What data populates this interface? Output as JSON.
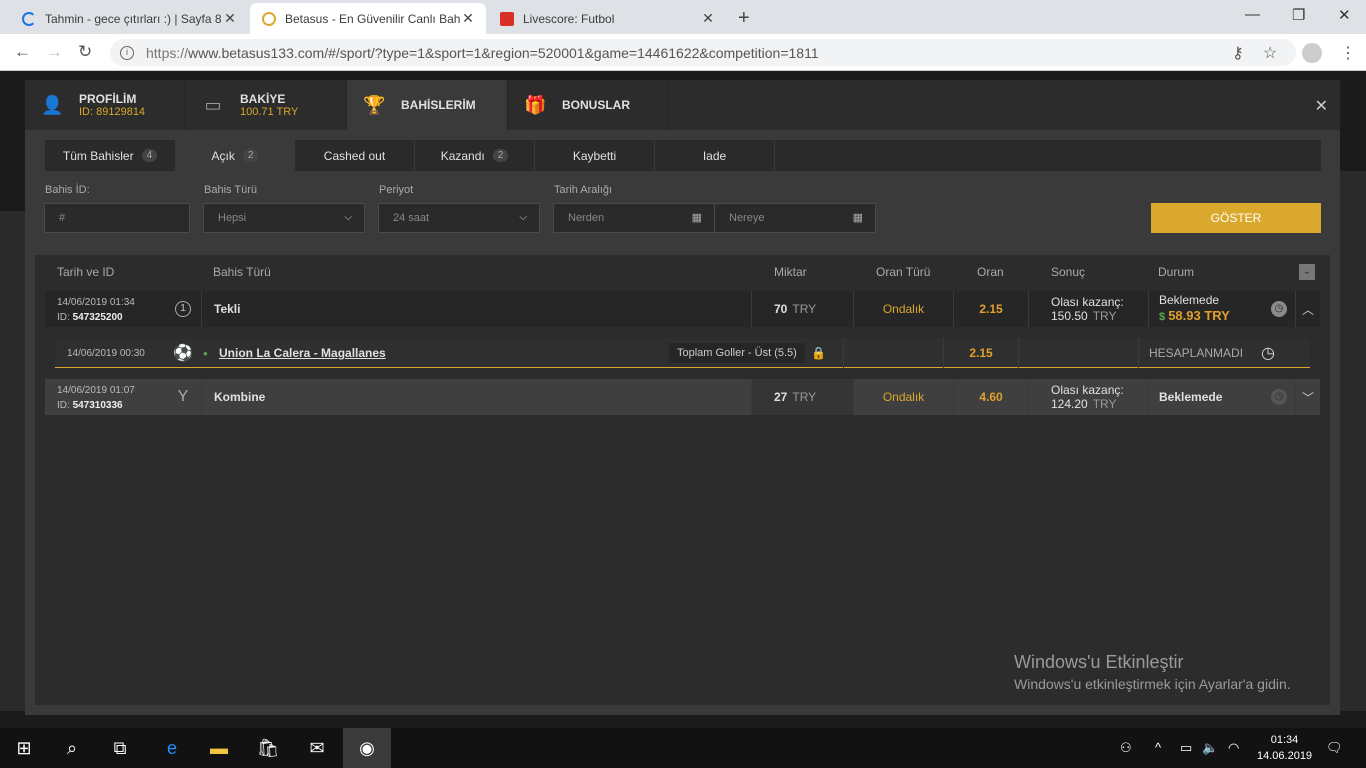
{
  "browser": {
    "tabs": [
      {
        "title": "Tahmin - gece çıtırları :) | Sayfa 8",
        "fav_color": "#1a73e8"
      },
      {
        "title": "Betasus - En Güvenilir Canlı Bahis",
        "fav_color": "#d9a82c"
      },
      {
        "title": "Livescore: Futbol",
        "fav_color": "#d93025"
      }
    ],
    "url_scheme": "https://",
    "url_rest": "www.betasus133.com/#/sport/?type=1&sport=1&region=520001&game=14461622&competition=1811"
  },
  "modal": {
    "tabs": [
      {
        "title": "PROFİLİM",
        "sub": "ID: 89129814",
        "icon": "user-icon"
      },
      {
        "title": "BAKİYE",
        "sub": "100.71 TRY",
        "icon": "wallet-icon"
      },
      {
        "title": "BAHİSLERİM",
        "sub": "",
        "icon": "trophy-icon"
      },
      {
        "title": "BONUSLAR",
        "sub": "",
        "icon": "gift-icon"
      }
    ],
    "subtabs": [
      {
        "label": "Tüm Bahisler",
        "count": "4"
      },
      {
        "label": "Açık",
        "count": "2"
      },
      {
        "label": "Cashed out",
        "count": ""
      },
      {
        "label": "Kazandı",
        "count": "2"
      },
      {
        "label": "Kaybetti",
        "count": ""
      },
      {
        "label": "Iade",
        "count": ""
      }
    ],
    "filters": {
      "bet_id_label": "Bahis İD:",
      "bet_id_placeholder": "#",
      "bet_type_label": "Bahis Türü",
      "bet_type_value": "Hepsi",
      "period_label": "Periyot",
      "period_value": "24 saat",
      "date_label": "Tarih Aralığı",
      "from": "Nerden",
      "to": "Nereye",
      "show": "GÖSTER"
    },
    "table": {
      "headers": [
        "Tarih ve ID",
        "Bahis Türü",
        "Miktar",
        "Oran Türü",
        "Oran",
        "Sonuç",
        "Durum"
      ],
      "rows": [
        {
          "date": "14/06/2019 01:34",
          "id_label": "ID:",
          "id": "547325200",
          "type": "Tekli",
          "type_icon": "1",
          "amount": "70",
          "cur": "TRY",
          "odds_type": "Ondalık",
          "odds": "2.15",
          "result_label": "Olası kazanç:",
          "result": "150.50",
          "status": "Beklemede",
          "cashout": "58.93 TRY"
        },
        {
          "date": "14/06/2019 01:07",
          "id_label": "ID:",
          "id": "547310336",
          "type": "Kombine",
          "type_icon": "Y",
          "amount": "27",
          "cur": "TRY",
          "odds_type": "Ondalık",
          "odds": "4.60",
          "result_label": "Olası kazanç:",
          "result": "124.20",
          "status": "Beklemede",
          "cashout": ""
        }
      ],
      "sub": {
        "date": "14/06/2019 00:30",
        "match": "Union La Calera - Magallanes",
        "market": "Toplam Goller - Üst (5.5)",
        "odds": "2.15",
        "status": "HESAPLANMADI"
      }
    }
  },
  "watermark": {
    "title": "Windows'u Etkinleştir",
    "text": "Windows'u etkinleştirmek için Ayarlar'a gidin."
  },
  "clock": {
    "time": "01:34",
    "date": "14.06.2019"
  }
}
